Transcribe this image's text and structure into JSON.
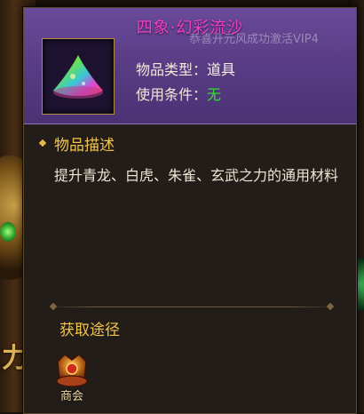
{
  "background": {
    "side_glyph": "力"
  },
  "item": {
    "name": "四象·幻彩流沙",
    "icon": "rainbow-sand-pile-icon",
    "properties": [
      {
        "label": "物品类型：",
        "value": "道具"
      },
      {
        "label": "使用条件：",
        "value": "无",
        "value_color": "#33e02e"
      }
    ]
  },
  "ticker": "恭喜开元风成功激活VIP4",
  "description": {
    "heading": "物品描述",
    "text": "提升青龙、白虎、朱雀、玄武之力的通用材料"
  },
  "source": {
    "heading": "获取途径",
    "entries": [
      {
        "label": "商会",
        "icon": "merchant-guild-icon"
      }
    ]
  },
  "colors": {
    "title": "#f040c8",
    "heading": "#f2c44d",
    "panel_header": "#5a3d86"
  }
}
